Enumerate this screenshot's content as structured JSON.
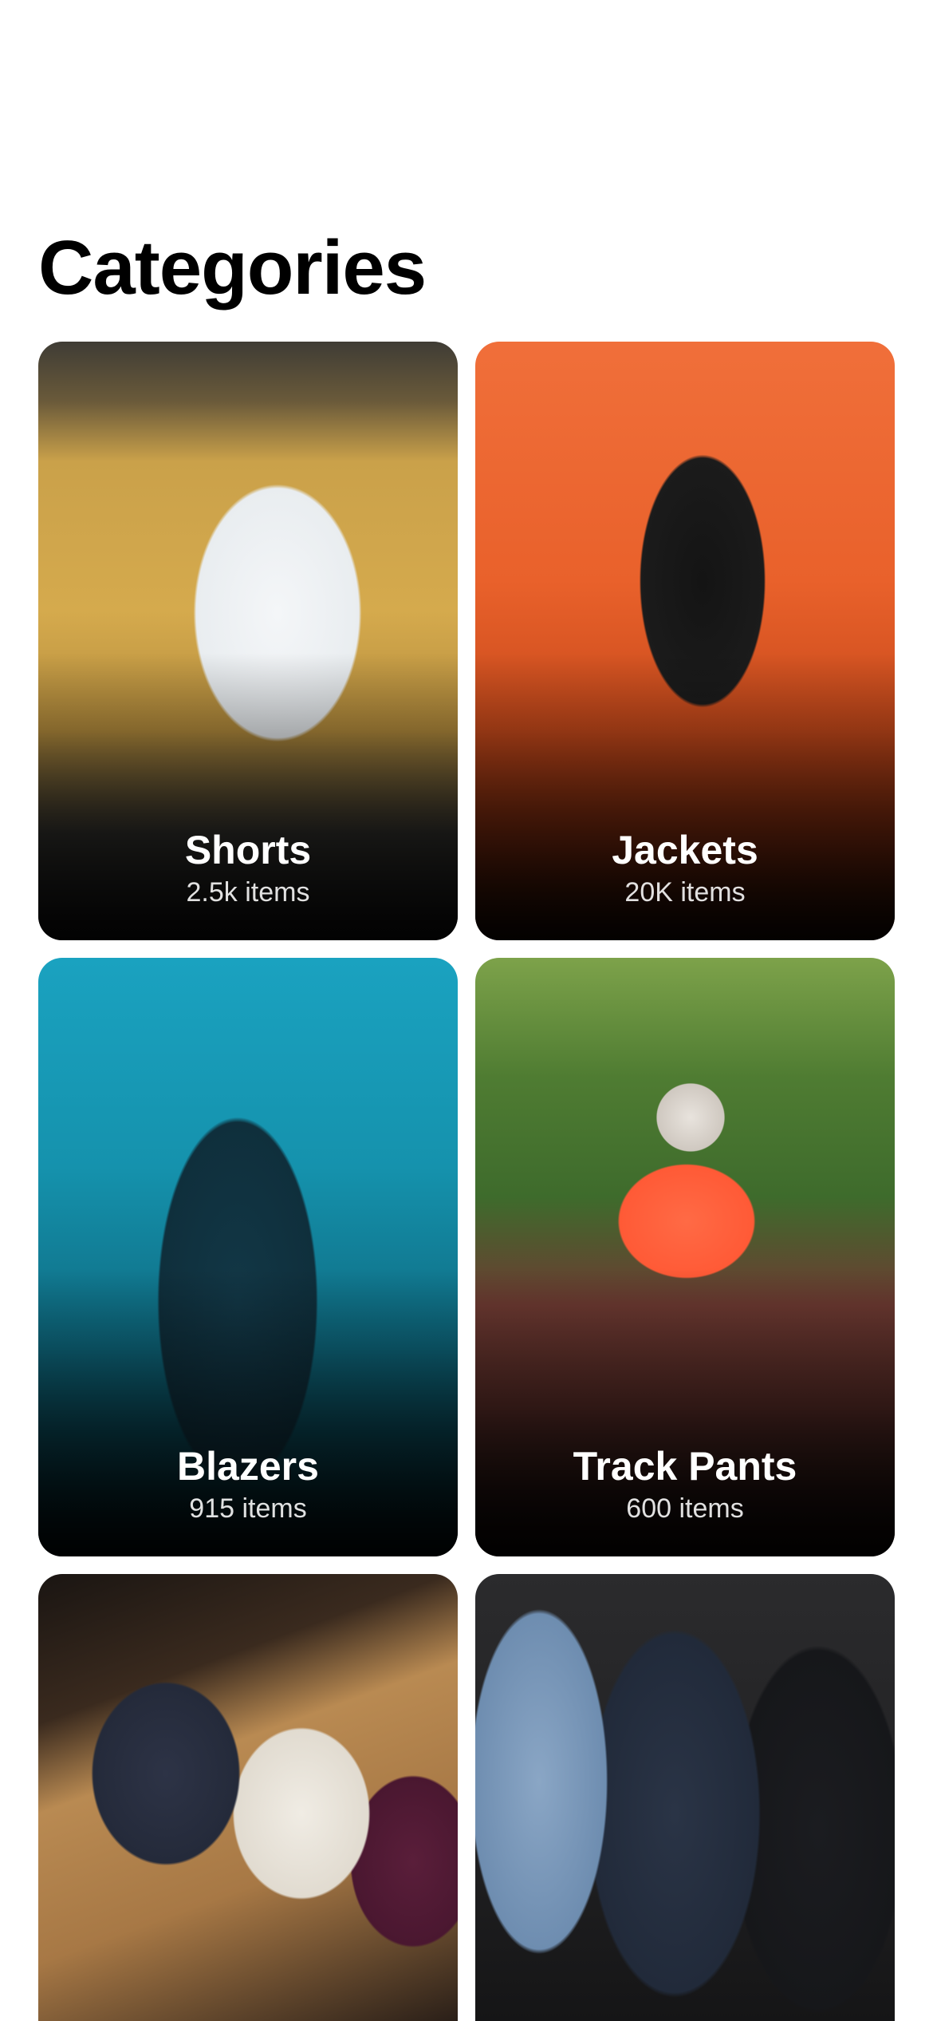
{
  "page": {
    "title": "Categories"
  },
  "categories": [
    {
      "name": "Shorts",
      "count": "2.5k items"
    },
    {
      "name": "Jackets",
      "count": "20K items"
    },
    {
      "name": "Blazers",
      "count": "915 items"
    },
    {
      "name": "Track Pants",
      "count": "600 items"
    },
    {
      "name": "",
      "count": ""
    },
    {
      "name": "",
      "count": ""
    }
  ],
  "colors": {
    "background": "#ffffff",
    "title": "#000000",
    "card_text": "#ffffff"
  }
}
